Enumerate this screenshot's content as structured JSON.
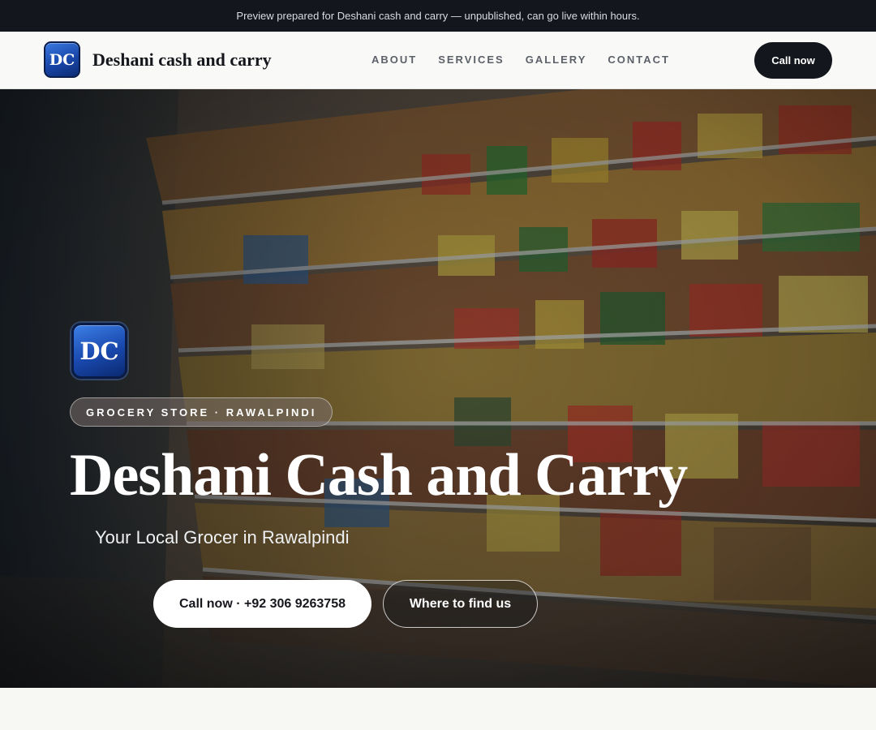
{
  "announcement": "Preview prepared for Deshani cash and carry — unpublished, can go live within hours.",
  "brand": {
    "initials": "DC",
    "name": "Deshani cash and carry"
  },
  "nav": {
    "links": [
      "ABOUT",
      "SERVICES",
      "GALLERY",
      "CONTACT"
    ],
    "call_label": "Call now"
  },
  "hero": {
    "badge": "GROCERY STORE · RAWALPINDI",
    "title": "Deshani Cash and Carry",
    "subtitle": "Your Local Grocer in Rawalpindi",
    "primary_button": "Call now · +92 306 9263758",
    "secondary_button": "Where to find us"
  },
  "colors": {
    "dark": "#13161c",
    "brand_blue": "#1846a8",
    "page_bg": "#f7f7f4"
  }
}
